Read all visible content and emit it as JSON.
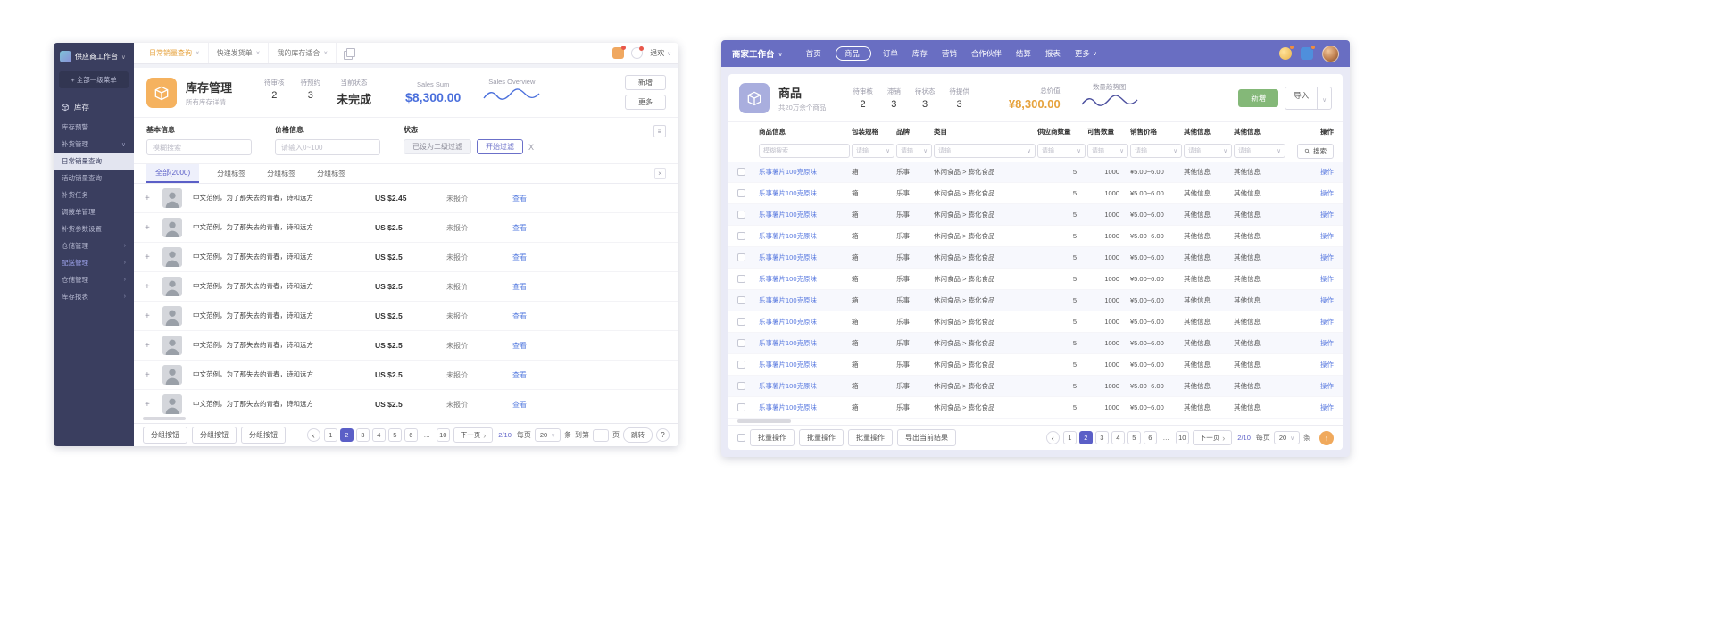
{
  "colors": {
    "accent_purple": "#5b5fc7",
    "topbar_purple": "#696ec2",
    "sidebar_navy": "#3a3e5f",
    "orange": "#e6a23c",
    "green": "#84b878",
    "sales_blue": "#4a6fdc"
  },
  "supplier": {
    "sidebar": {
      "title": "供应商工作台",
      "menu_toggle": "+ 全部一级菜单",
      "section": "库存",
      "items": [
        {
          "label": "库存预警",
          "suffix": "",
          "cls": ""
        },
        {
          "label": "补货管理",
          "suffix": "∨",
          "cls": ""
        },
        {
          "label": "日常销量查询",
          "suffix": "",
          "cls": "active"
        },
        {
          "label": "活动销量查询",
          "suffix": "",
          "cls": ""
        },
        {
          "label": "补货任务",
          "suffix": "",
          "cls": ""
        },
        {
          "label": "调拨单管理",
          "suffix": "",
          "cls": ""
        },
        {
          "label": "补货参数设置",
          "suffix": "",
          "cls": ""
        },
        {
          "label": "仓储管理",
          "suffix": "›",
          "cls": ""
        },
        {
          "label": "配送管理",
          "suffix": "›",
          "cls": "purple"
        },
        {
          "label": "仓储管理",
          "suffix": "›",
          "cls": ""
        },
        {
          "label": "库存报表",
          "suffix": "›",
          "cls": ""
        }
      ]
    },
    "tabs": [
      {
        "label": "日常销量查询",
        "cls": "active"
      },
      {
        "label": "快递发货单",
        "cls": ""
      },
      {
        "label": "我的库存适合",
        "cls": ""
      }
    ],
    "user_name": "退欢",
    "header": {
      "title": "库存管理",
      "subtitle": "所有库存详情",
      "stats": [
        {
          "label": "待审核",
          "value": "2",
          "cls": ""
        },
        {
          "label": "待预约",
          "value": "3",
          "cls": ""
        },
        {
          "label": "当前状态",
          "value": "未完成",
          "cls": "strong"
        }
      ],
      "sales_sum_label": "Sales Sum",
      "sales_sum_value": "$8,300.00",
      "overview_label": "Sales Overview",
      "new_button": "新增",
      "more_button": "更多"
    },
    "filters": {
      "basic_label": "基本信息",
      "basic_placeholder": "模糊搜索",
      "price_label": "价格信息",
      "price_placeholder": "请输入0~100",
      "status_label": "状态",
      "status_tag": "已设为二级过滤",
      "filter_button": "开始过滤",
      "clear_button": "X"
    },
    "seg_tabs": [
      {
        "label": "全部(2000)",
        "cls": "active"
      },
      {
        "label": "分组标签",
        "cls": ""
      },
      {
        "label": "分组标签",
        "cls": ""
      },
      {
        "label": "分组标签",
        "cls": ""
      }
    ],
    "rows": [
      {
        "text": "中文范例，为了那失去的青春，诗和远方",
        "price": "US $2.45",
        "status": "未报价",
        "action": "查看"
      },
      {
        "text": "中文范例，为了那失去的青春，诗和远方",
        "price": "US $2.5",
        "status": "未报价",
        "action": "查看"
      },
      {
        "text": "中文范例，为了那失去的青春，诗和远方",
        "price": "US $2.5",
        "status": "未报价",
        "action": "查看"
      },
      {
        "text": "中文范例，为了那失去的青春，诗和远方",
        "price": "US $2.5",
        "status": "未报价",
        "action": "查看"
      },
      {
        "text": "中文范例，为了那失去的青春，诗和远方",
        "price": "US $2.5",
        "status": "未报价",
        "action": "查看"
      },
      {
        "text": "中文范例，为了那失去的青春，诗和远方",
        "price": "US $2.5",
        "status": "未报价",
        "action": "查看"
      },
      {
        "text": "中文范例，为了那失去的青春，诗和远方",
        "price": "US $2.5",
        "status": "未报价",
        "action": "查看"
      },
      {
        "text": "中文范例，为了那失去的青春，诗和远方",
        "price": "US $2.5",
        "status": "未报价",
        "action": "查看"
      }
    ],
    "footer": {
      "group_buttons": [
        {
          "label": "分组按钮"
        },
        {
          "label": "分组按钮"
        },
        {
          "label": "分组按钮"
        }
      ],
      "pages": [
        {
          "n": "1",
          "cls": ""
        },
        {
          "n": "2",
          "cls": "active"
        },
        {
          "n": "3",
          "cls": ""
        },
        {
          "n": "4",
          "cls": ""
        },
        {
          "n": "5",
          "cls": ""
        },
        {
          "n": "6",
          "cls": ""
        },
        {
          "n": "…",
          "cls": "dots"
        },
        {
          "n": "10",
          "cls": ""
        }
      ],
      "next_label": "下一页",
      "page_info": "2/10",
      "per_page_label": "每页",
      "per_page_value": "20",
      "unit_label": "条",
      "goto_label": "到第",
      "goto_unit": "页",
      "jump_label": "跳转"
    }
  },
  "merchant": {
    "topbar": {
      "title": "商家工作台",
      "nav": [
        {
          "label": "首页",
          "suffix": "",
          "cls": ""
        },
        {
          "label": "商品",
          "suffix": "",
          "cls": "pill"
        },
        {
          "label": "订单",
          "suffix": "",
          "cls": ""
        },
        {
          "label": "库存",
          "suffix": "",
          "cls": ""
        },
        {
          "label": "营销",
          "suffix": "",
          "cls": ""
        },
        {
          "label": "合作伙伴",
          "suffix": "",
          "cls": ""
        },
        {
          "label": "结算",
          "suffix": "",
          "cls": ""
        },
        {
          "label": "报表",
          "suffix": "",
          "cls": ""
        },
        {
          "label": "更多",
          "suffix": "∨",
          "cls": ""
        }
      ]
    },
    "header": {
      "title": "商品",
      "subtitle": "共20万余个商品",
      "stats": [
        {
          "label": "待审核",
          "value": "2"
        },
        {
          "label": "滞销",
          "value": "3"
        },
        {
          "label": "待状态",
          "value": "3"
        },
        {
          "label": "待提供",
          "value": "3"
        }
      ],
      "total_label": "总价值",
      "total_value": "¥8,300.00",
      "trend_label": "数量趋势图",
      "new_button": "新增",
      "import_button": "导入"
    },
    "table": {
      "headers": [
        {
          "label": "商品信息"
        },
        {
          "label": "包装规格"
        },
        {
          "label": "品牌"
        },
        {
          "label": "类目"
        },
        {
          "label": "供应商数量"
        },
        {
          "label": "可售数量"
        },
        {
          "label": "销售价格"
        },
        {
          "label": "其他信息"
        },
        {
          "label": "其他信息"
        },
        {
          "label": "操作"
        }
      ],
      "search_placeholder": "模糊搜索",
      "select_placeholder": "请输",
      "search_button": "搜索",
      "rows": [
        {
          "name": "乐事薯片100克原味",
          "spec": "箱",
          "brand": "乐事",
          "category": "休闲食品 > 膨化食品",
          "suppliers": "5",
          "sellable": "1000",
          "price": "¥5.00~6.00",
          "other1": "其他信息",
          "other2": "其他信息",
          "action": "操作"
        },
        {
          "name": "乐事薯片100克原味",
          "spec": "箱",
          "brand": "乐事",
          "category": "休闲食品 > 膨化食品",
          "suppliers": "5",
          "sellable": "1000",
          "price": "¥5.00~6.00",
          "other1": "其他信息",
          "other2": "其他信息",
          "action": "操作"
        },
        {
          "name": "乐事薯片100克原味",
          "spec": "箱",
          "brand": "乐事",
          "category": "休闲食品 > 膨化食品",
          "suppliers": "5",
          "sellable": "1000",
          "price": "¥5.00~6.00",
          "other1": "其他信息",
          "other2": "其他信息",
          "action": "操作"
        },
        {
          "name": "乐事薯片100克原味",
          "spec": "箱",
          "brand": "乐事",
          "category": "休闲食品 > 膨化食品",
          "suppliers": "5",
          "sellable": "1000",
          "price": "¥5.00~6.00",
          "other1": "其他信息",
          "other2": "其他信息",
          "action": "操作"
        },
        {
          "name": "乐事薯片100克原味",
          "spec": "箱",
          "brand": "乐事",
          "category": "休闲食品 > 膨化食品",
          "suppliers": "5",
          "sellable": "1000",
          "price": "¥5.00~6.00",
          "other1": "其他信息",
          "other2": "其他信息",
          "action": "操作"
        },
        {
          "name": "乐事薯片100克原味",
          "spec": "箱",
          "brand": "乐事",
          "category": "休闲食品 > 膨化食品",
          "suppliers": "5",
          "sellable": "1000",
          "price": "¥5.00~6.00",
          "other1": "其他信息",
          "other2": "其他信息",
          "action": "操作"
        },
        {
          "name": "乐事薯片100克原味",
          "spec": "箱",
          "brand": "乐事",
          "category": "休闲食品 > 膨化食品",
          "suppliers": "5",
          "sellable": "1000",
          "price": "¥5.00~6.00",
          "other1": "其他信息",
          "other2": "其他信息",
          "action": "操作"
        },
        {
          "name": "乐事薯片100克原味",
          "spec": "箱",
          "brand": "乐事",
          "category": "休闲食品 > 膨化食品",
          "suppliers": "5",
          "sellable": "1000",
          "price": "¥5.00~6.00",
          "other1": "其他信息",
          "other2": "其他信息",
          "action": "操作"
        },
        {
          "name": "乐事薯片100克原味",
          "spec": "箱",
          "brand": "乐事",
          "category": "休闲食品 > 膨化食品",
          "suppliers": "5",
          "sellable": "1000",
          "price": "¥5.00~6.00",
          "other1": "其他信息",
          "other2": "其他信息",
          "action": "操作"
        },
        {
          "name": "乐事薯片100克原味",
          "spec": "箱",
          "brand": "乐事",
          "category": "休闲食品 > 膨化食品",
          "suppliers": "5",
          "sellable": "1000",
          "price": "¥5.00~6.00",
          "other1": "其他信息",
          "other2": "其他信息",
          "action": "操作"
        },
        {
          "name": "乐事薯片100克原味",
          "spec": "箱",
          "brand": "乐事",
          "category": "休闲食品 > 膨化食品",
          "suppliers": "5",
          "sellable": "1000",
          "price": "¥5.00~6.00",
          "other1": "其他信息",
          "other2": "其他信息",
          "action": "操作"
        },
        {
          "name": "乐事薯片100克原味",
          "spec": "箱",
          "brand": "乐事",
          "category": "休闲食品 > 膨化食品",
          "suppliers": "5",
          "sellable": "1000",
          "price": "¥5.00~6.00",
          "other1": "其他信息",
          "other2": "其他信息",
          "action": "操作"
        }
      ]
    },
    "footer": {
      "bulk_buttons": [
        {
          "label": "批量操作"
        },
        {
          "label": "批量操作"
        },
        {
          "label": "批量操作"
        },
        {
          "label": "导出当前结果"
        }
      ],
      "pages": [
        {
          "n": "1",
          "cls": ""
        },
        {
          "n": "2",
          "cls": "active"
        },
        {
          "n": "3",
          "cls": ""
        },
        {
          "n": "4",
          "cls": ""
        },
        {
          "n": "5",
          "cls": ""
        },
        {
          "n": "6",
          "cls": ""
        },
        {
          "n": "…",
          "cls": "dots"
        },
        {
          "n": "10",
          "cls": ""
        }
      ],
      "next_label": "下一页",
      "page_info": "2/10",
      "per_page_label": "每页",
      "per_page_value": "20",
      "unit_label": "条"
    }
  }
}
